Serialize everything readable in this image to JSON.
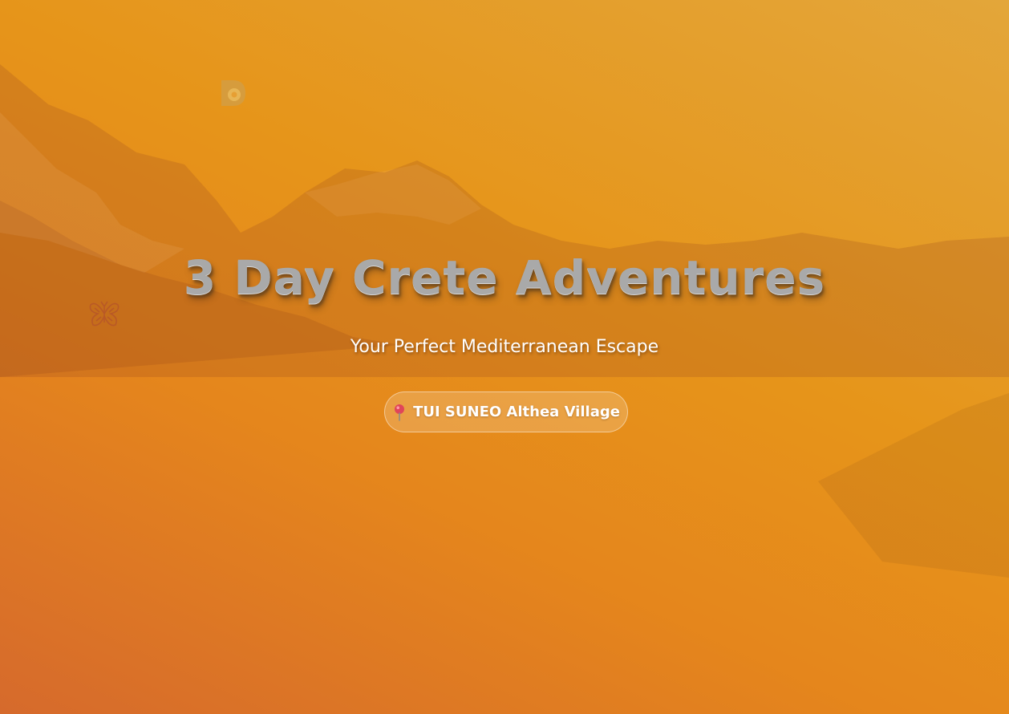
{
  "hero": {
    "title": "3 Day Crete Adventures",
    "subtitle": "Your Perfect Mediterranean Escape",
    "location": {
      "icon": "map-pin-icon",
      "label": "TUI SUNEO Althea Village"
    }
  },
  "decorations": {
    "top_left_icon": "logo-mark-icon",
    "left_icon": "butterfly-icon"
  },
  "colors": {
    "background_top": "#e6951a",
    "background_bottom_left": "#d66a2c",
    "title_text": "#a9a9a9",
    "subtitle_text": "#ffffff",
    "pin": "#e0455a"
  }
}
